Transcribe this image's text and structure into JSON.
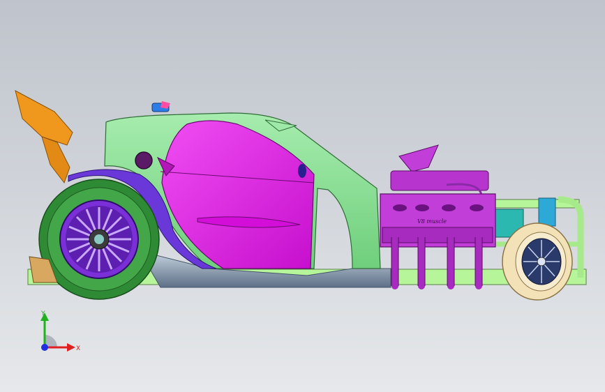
{
  "viewport": {
    "background_top": "#bfc4cc",
    "background_bottom": "#e6e8eb"
  },
  "model": {
    "engine_plate_text": "V8 muscle",
    "colors": {
      "body": "#8fe39a",
      "door": "#e11ee6",
      "engine": "#c23ed9",
      "tire": "#2f8a36",
      "wing": "#f0971e",
      "frame": "#b7f59a",
      "rim": "#7b2fd6",
      "front_tire": "#f3e2b7",
      "underbody": "#7c8fa3"
    }
  },
  "triad": {
    "x_label": "X",
    "y_label": "Y",
    "x_color": "#e02020",
    "y_color": "#20b020",
    "z_color": "#2030e0"
  }
}
